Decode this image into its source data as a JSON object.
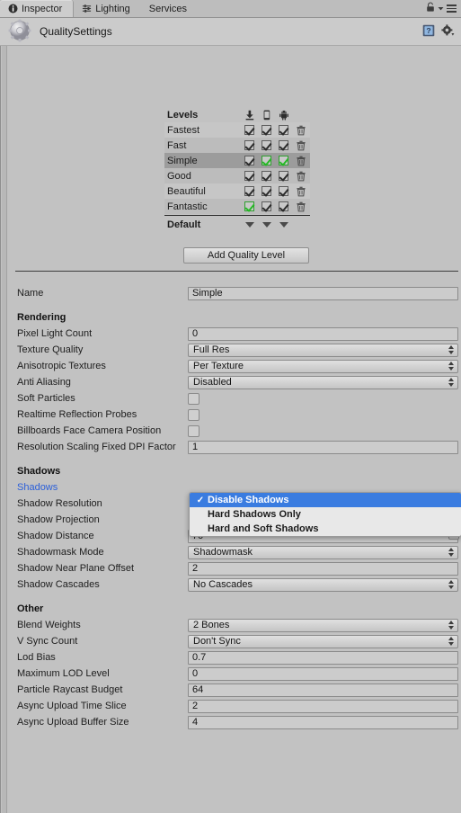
{
  "window": {
    "tabs": [
      {
        "label": "Inspector",
        "icon": "info-icon",
        "active": true
      },
      {
        "label": "Lighting",
        "icon": "lighting-icon",
        "active": false
      },
      {
        "label": "Services",
        "icon": "",
        "active": false
      }
    ],
    "lock_icon": "lock-icon",
    "menu_icon": "hamburger-menu-icon"
  },
  "object_header": {
    "icon": "quality-settings-gear-icon",
    "title": "QualitySettings",
    "help_icon": "help-book-icon",
    "settings_icon": "gear-dropdown-icon"
  },
  "levels_table": {
    "name_header": "Levels",
    "platform_columns": [
      {
        "name": "standalone-platform-icon",
        "glyph": "download"
      },
      {
        "name": "ios-platform-icon",
        "glyph": "phone"
      },
      {
        "name": "android-platform-icon",
        "glyph": "android"
      }
    ],
    "rows": [
      {
        "label": "Fastest",
        "selected": false,
        "checks": [
          {
            "on": true,
            "green": false
          },
          {
            "on": true,
            "green": false
          },
          {
            "on": true,
            "green": false
          }
        ]
      },
      {
        "label": "Fast",
        "selected": false,
        "checks": [
          {
            "on": true,
            "green": false
          },
          {
            "on": true,
            "green": false
          },
          {
            "on": true,
            "green": false
          }
        ]
      },
      {
        "label": "Simple",
        "selected": true,
        "checks": [
          {
            "on": true,
            "green": false
          },
          {
            "on": true,
            "green": true
          },
          {
            "on": true,
            "green": true
          }
        ]
      },
      {
        "label": "Good",
        "selected": false,
        "checks": [
          {
            "on": true,
            "green": false
          },
          {
            "on": true,
            "green": false
          },
          {
            "on": true,
            "green": false
          }
        ]
      },
      {
        "label": "Beautiful",
        "selected": false,
        "checks": [
          {
            "on": true,
            "green": false
          },
          {
            "on": true,
            "green": false
          },
          {
            "on": true,
            "green": false
          }
        ]
      },
      {
        "label": "Fantastic",
        "selected": false,
        "checks": [
          {
            "on": true,
            "green": true
          },
          {
            "on": true,
            "green": false
          },
          {
            "on": true,
            "green": false
          }
        ]
      }
    ],
    "default_label": "Default",
    "delete_icon": "trash-icon"
  },
  "add_quality_level_button": "Add Quality Level",
  "name_row": {
    "label": "Name",
    "value": "Simple"
  },
  "sections": {
    "rendering": {
      "title": "Rendering",
      "rows": [
        {
          "label": "Pixel Light Count",
          "type": "text",
          "value": "0"
        },
        {
          "label": "Texture Quality",
          "type": "popup",
          "value": "Full Res"
        },
        {
          "label": "Anisotropic Textures",
          "type": "popup",
          "value": "Per Texture"
        },
        {
          "label": "Anti Aliasing",
          "type": "popup",
          "value": "Disabled"
        },
        {
          "label": "Soft Particles",
          "type": "toggle",
          "value": false
        },
        {
          "label": "Realtime Reflection Probes",
          "type": "toggle",
          "value": false
        },
        {
          "label": "Billboards Face Camera Position",
          "type": "toggle",
          "value": false
        },
        {
          "label": "Resolution Scaling Fixed DPI Factor",
          "type": "text",
          "value": "1"
        }
      ]
    },
    "shadows": {
      "title": "Shadows",
      "rows": [
        {
          "label": "Shadows",
          "type": "popup",
          "value": "Disable Shadows",
          "highlight": true,
          "hidden_by_popup": true
        },
        {
          "label": "Shadow Resolution",
          "type": "popup",
          "value": "",
          "hidden_by_popup": true
        },
        {
          "label": "Shadow Projection",
          "type": "popup",
          "value": "",
          "hidden_by_popup": true
        },
        {
          "label": "Shadow Distance",
          "type": "text",
          "value": "70"
        },
        {
          "label": "Shadowmask Mode",
          "type": "popup",
          "value": "Shadowmask"
        },
        {
          "label": "Shadow Near Plane Offset",
          "type": "text",
          "value": "2"
        },
        {
          "label": "Shadow Cascades",
          "type": "popup",
          "value": "No Cascades"
        }
      ]
    },
    "other": {
      "title": "Other",
      "rows": [
        {
          "label": "Blend Weights",
          "type": "popup",
          "value": "2 Bones"
        },
        {
          "label": "V Sync Count",
          "type": "popup",
          "value": "Don't Sync"
        },
        {
          "label": "Lod Bias",
          "type": "text",
          "value": "0.7"
        },
        {
          "label": "Maximum LOD Level",
          "type": "text",
          "value": "0"
        },
        {
          "label": "Particle Raycast Budget",
          "type": "text",
          "value": "64"
        },
        {
          "label": "Async Upload Time Slice",
          "type": "text",
          "value": "2"
        },
        {
          "label": "Async Upload Buffer Size",
          "type": "text",
          "value": "4"
        }
      ]
    }
  },
  "shadows_dropdown": {
    "open": true,
    "selected_index": 0,
    "options": [
      "Disable Shadows",
      "Hard Shadows Only",
      "Hard and Soft Shadows"
    ],
    "check_glyph": "✓",
    "highlight_color": "#3a7ce0"
  }
}
